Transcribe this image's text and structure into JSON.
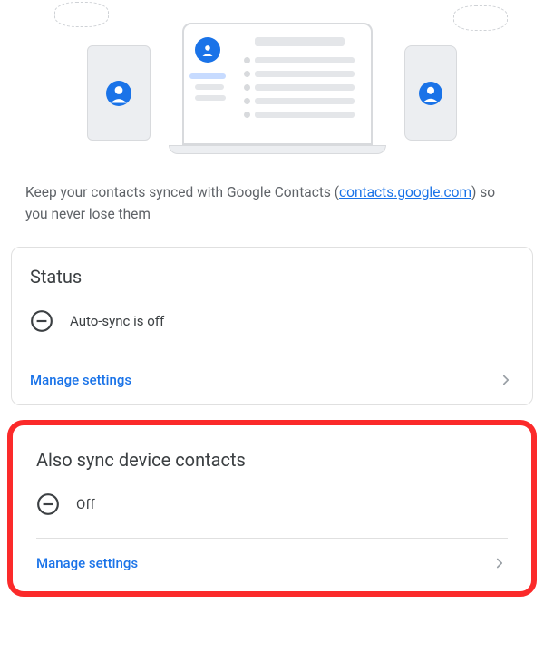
{
  "hero": {
    "illustration": "sync-devices-illustration"
  },
  "description": {
    "prefix": "Keep your contacts synced with Google Contacts (",
    "link_text": "contacts.google.com",
    "suffix": ") so you never lose them"
  },
  "card_status": {
    "title": "Status",
    "status_text": "Auto-sync is off",
    "action_label": "Manage settings"
  },
  "card_device": {
    "title": "Also sync device contacts",
    "status_text": "Off",
    "action_label": "Manage settings"
  }
}
